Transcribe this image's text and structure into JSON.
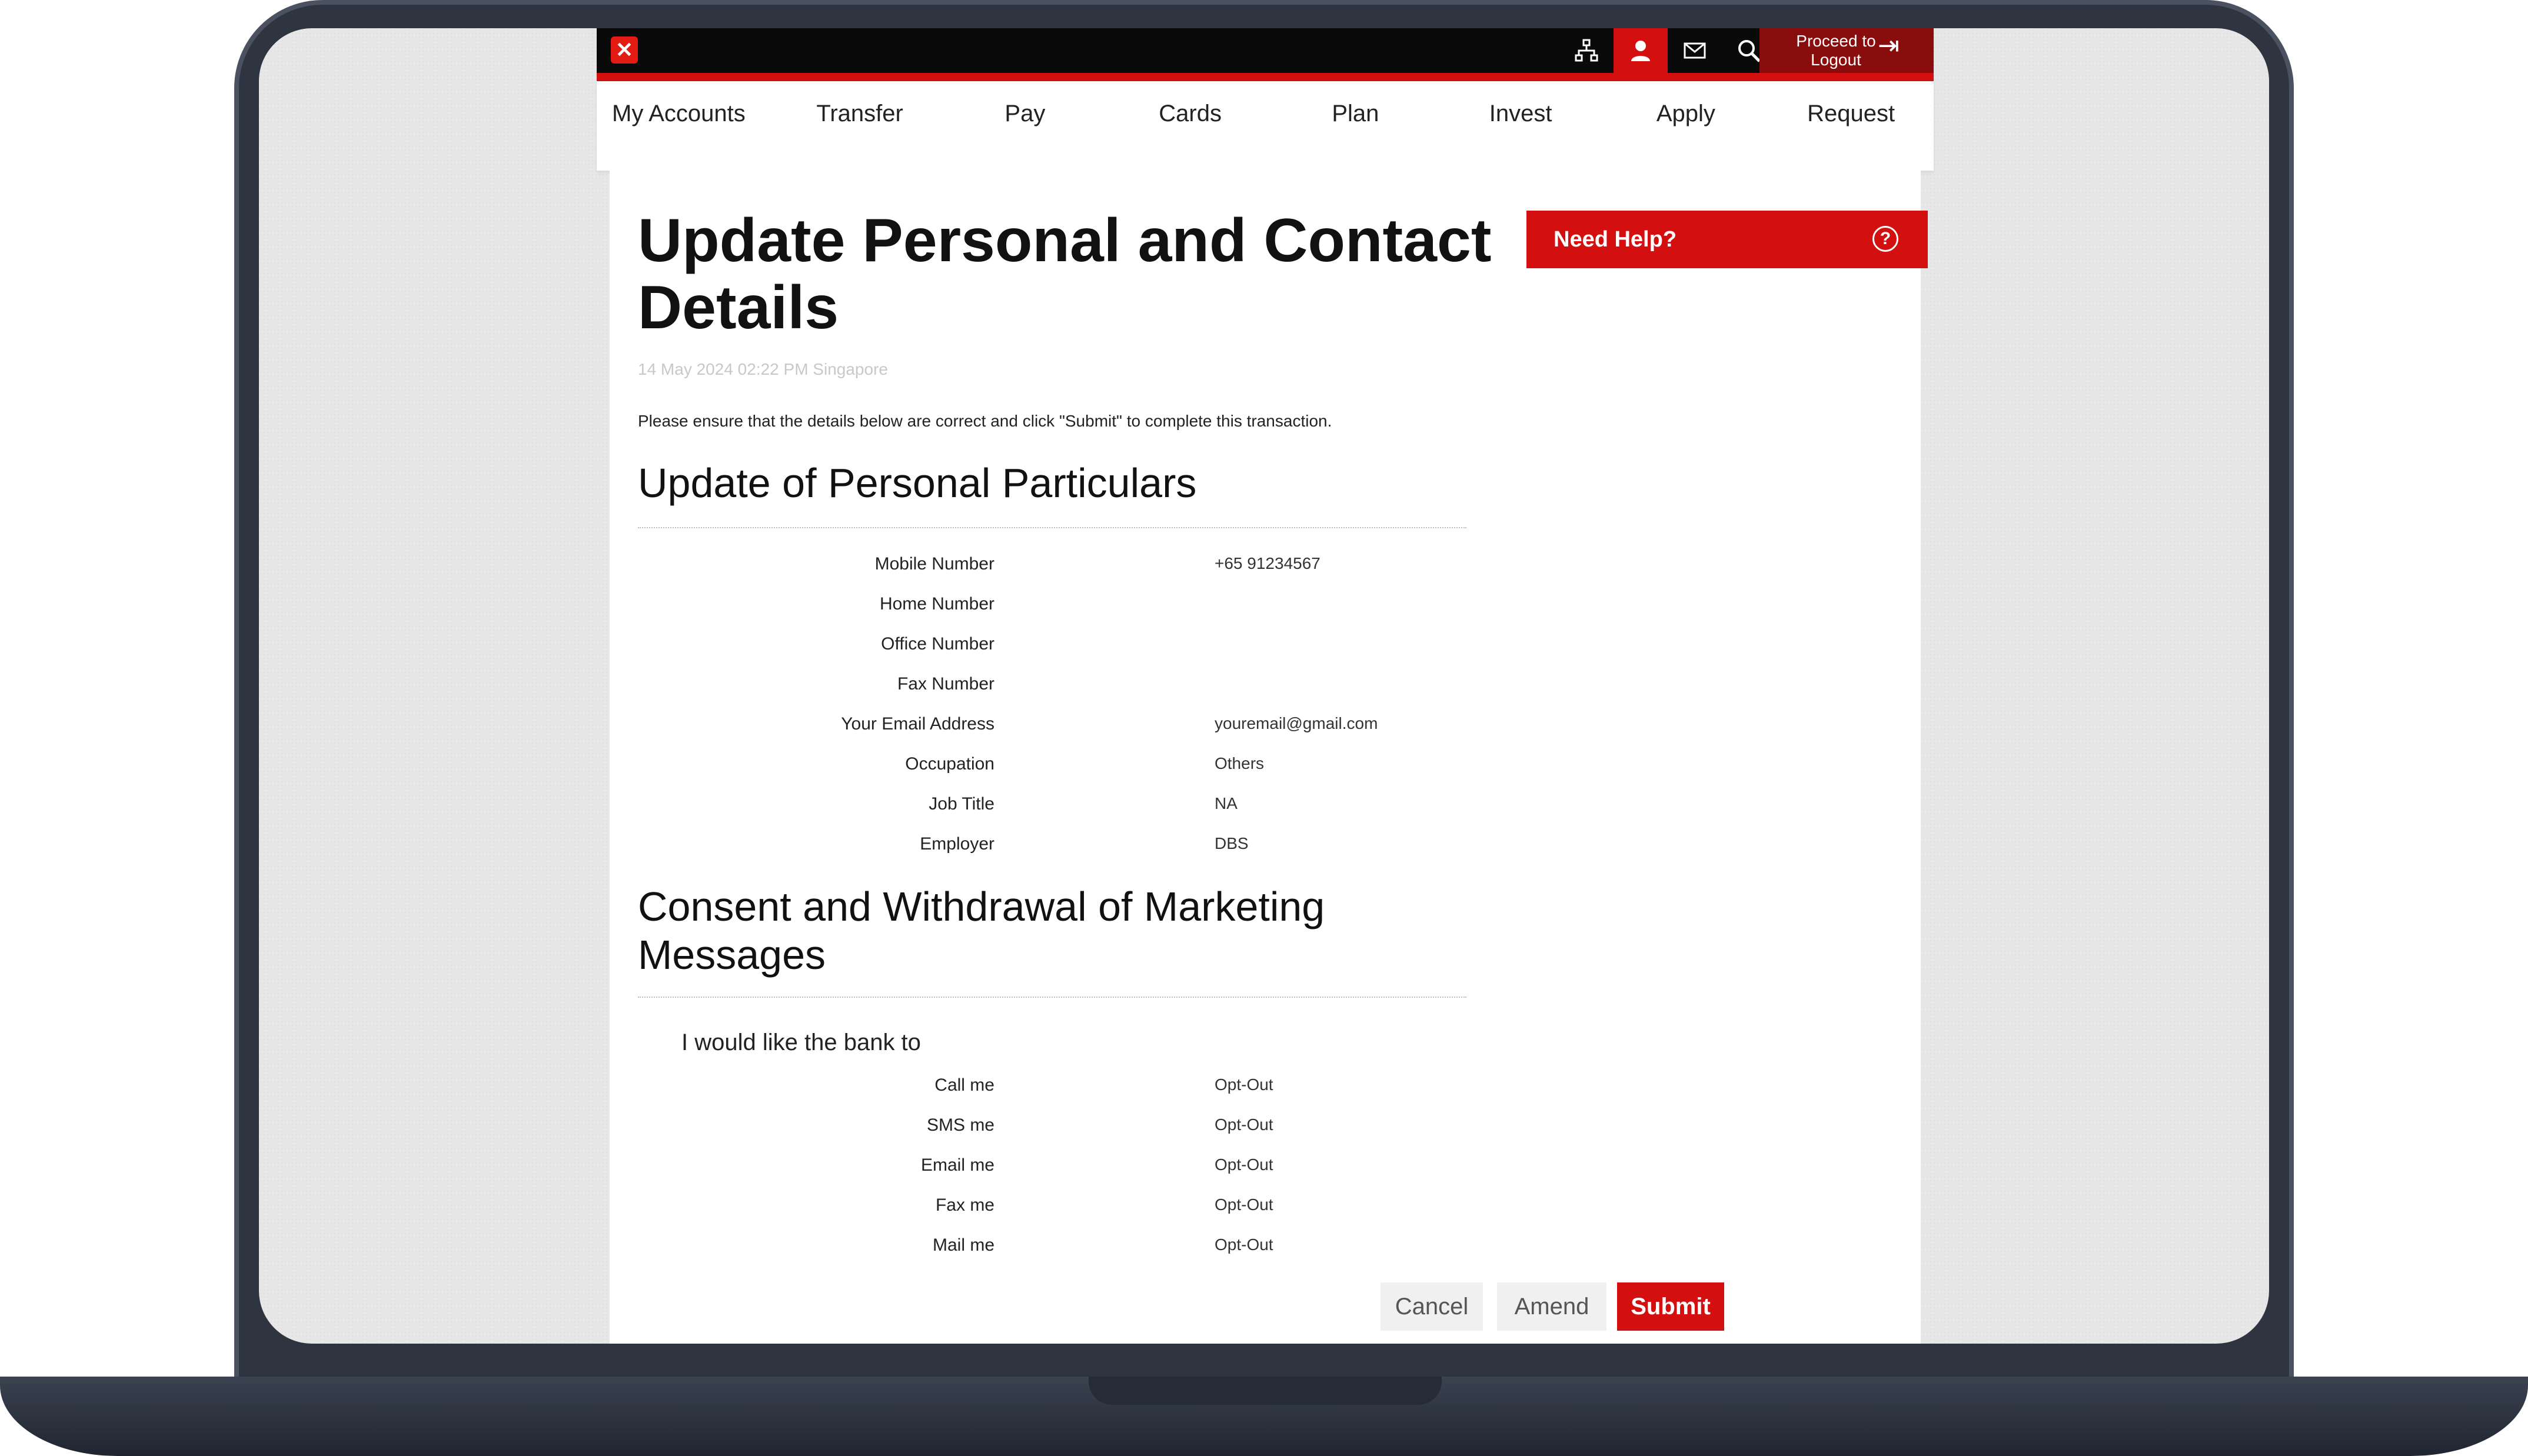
{
  "topbar": {
    "logo_glyph": "✕",
    "icons": [
      "sitemap-icon",
      "user-icon",
      "mail-icon",
      "search-icon"
    ],
    "logout_label": "Proceed to Logout",
    "accent_color": "#d30f0f"
  },
  "nav": [
    "My Accounts",
    "Transfer",
    "Pay",
    "Cards",
    "Plan",
    "Invest",
    "Apply",
    "Request"
  ],
  "page": {
    "title": "Update Personal and Contact Details",
    "timestamp": "14 May 2024 02:22 PM Singapore",
    "instruction": "Please ensure that the details below are correct and click \"Submit\" to complete this transaction."
  },
  "personal": {
    "title": "Update of Personal Particulars",
    "fields": [
      {
        "label": "Mobile Number",
        "value": "+65 91234567"
      },
      {
        "label": "Home Number",
        "value": ""
      },
      {
        "label": "Office Number",
        "value": ""
      },
      {
        "label": "Fax Number",
        "value": ""
      },
      {
        "label": "Your Email Address",
        "value": "youremail@gmail.com"
      },
      {
        "label": "Occupation",
        "value": "Others"
      },
      {
        "label": "Job Title",
        "value": "NA"
      },
      {
        "label": "Employer",
        "value": "DBS"
      }
    ]
  },
  "consent": {
    "title": "Consent and Withdrawal of Marketing Messages",
    "intro": "I would like the bank to",
    "fields": [
      {
        "label": "Call me",
        "value": "Opt-Out"
      },
      {
        "label": "SMS me",
        "value": "Opt-Out"
      },
      {
        "label": "Email me",
        "value": "Opt-Out"
      },
      {
        "label": "Fax me",
        "value": "Opt-Out"
      },
      {
        "label": "Mail me",
        "value": "Opt-Out"
      }
    ]
  },
  "buttons": {
    "cancel": "Cancel",
    "amend": "Amend",
    "submit": "Submit"
  },
  "help": {
    "label": "Need Help?",
    "icon_glyph": "?"
  }
}
